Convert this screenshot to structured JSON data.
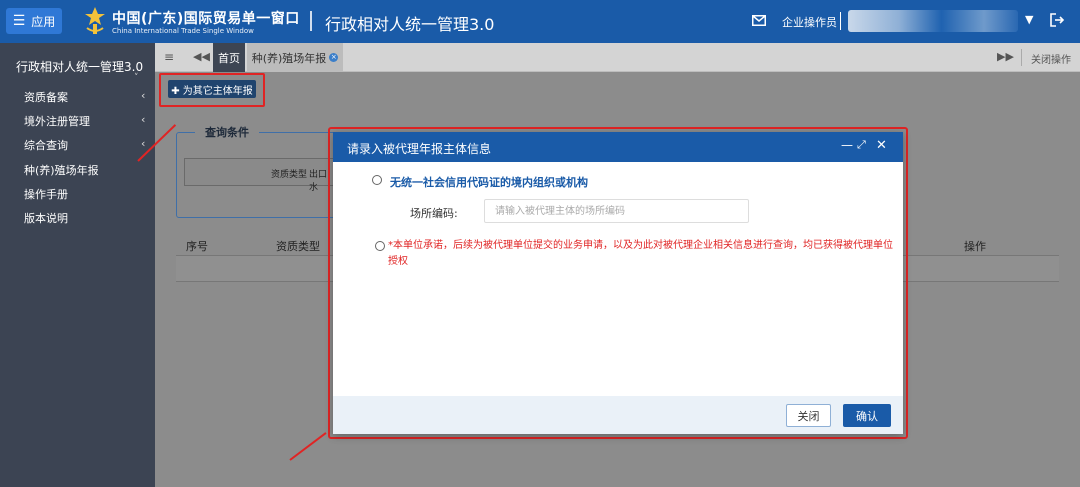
{
  "header": {
    "app_button": "应用",
    "brand_cn": "中国(广东)国际贸易单一窗口",
    "brand_en": "China International Trade Single Window",
    "system_name": "行政相对人统一管理3.0",
    "user_label": "企业操作员",
    "menu_glyph": "☰",
    "caret_glyph": "▼"
  },
  "sidebar": {
    "title": "行政相对人统一管理3.0",
    "title_caret": "˅",
    "items": [
      {
        "label": "资质备案",
        "chevron": "‹"
      },
      {
        "label": "境外注册管理",
        "chevron": "‹"
      },
      {
        "label": "综合查询",
        "chevron": "‹"
      },
      {
        "label": "种(养)殖场年报",
        "chevron": ""
      },
      {
        "label": "操作手册",
        "chevron": ""
      },
      {
        "label": "版本说明",
        "chevron": ""
      }
    ]
  },
  "tabbar": {
    "menu_glyph": "≡",
    "prev_glyph": "◀◀",
    "home_tab": "首页",
    "active_tab": "种(养)殖场年报",
    "close_glyph": "×",
    "next_glyph": "▶▶",
    "close_ops": "关闭操作"
  },
  "content": {
    "proxy_button": "✚ 为其它主体年报",
    "query_legend": "查询条件",
    "filter_label": "资质类型",
    "filter_value": "出口水",
    "table_headers": {
      "seq": "序号",
      "type": "资质类型",
      "ops": "操作"
    }
  },
  "modal": {
    "title": "请录入被代理年报主体信息",
    "min_glyph": "—",
    "max_glyph": "⤢",
    "close_glyph": "✕",
    "option1_label": "无统一社会信用代码证的境内组织或机构",
    "field_label": "场所编码:",
    "field_placeholder": "请输入被代理主体的场所编码",
    "commitment": "*本单位承诺，后续为被代理单位提交的业务申请，以及为此对被代理企业相关信息进行查询，均已获得被代理单位授权",
    "close_button": "关闭",
    "ok_button": "确认"
  },
  "colors": {
    "primary": "#1a5ba8",
    "sidebar": "#3c4453",
    "annotation_red": "#e02424"
  }
}
